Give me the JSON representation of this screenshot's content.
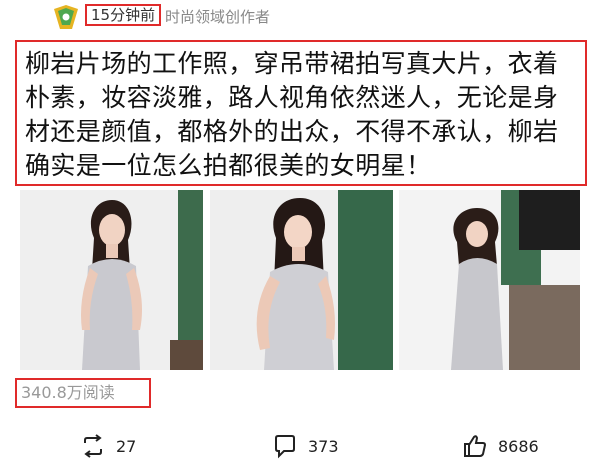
{
  "header": {
    "time_text": "15分钟前",
    "author_tag": "时尚领域创作者"
  },
  "post": {
    "text": "柳岩片场的工作照，穿吊带裙拍写真大片，衣着朴素，妆容淡雅，路人视角依然迷人，无论是身材还是颜值，都格外的出众，不得不承认，柳岩确实是一位怎么拍都很美的女明星！"
  },
  "images": [
    {
      "icon": "photo-1"
    },
    {
      "icon": "photo-2"
    },
    {
      "icon": "photo-3"
    }
  ],
  "stats": {
    "reads": "340.8万阅读"
  },
  "actions": {
    "repost_count": "27",
    "comment_count": "373",
    "like_count": "8686"
  },
  "colors": {
    "highlight_border": "#e02a2a",
    "meta_text": "#888888"
  }
}
